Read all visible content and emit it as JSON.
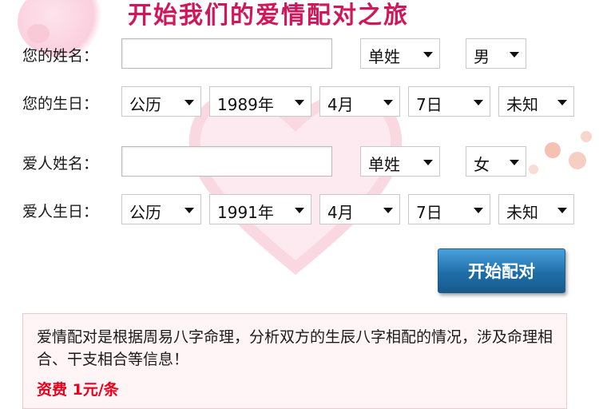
{
  "header": {
    "title": "开始我们的爱情配对之旅"
  },
  "form": {
    "your_name": {
      "label": "您的姓名：",
      "value": "",
      "surname_type": "单姓",
      "gender": "男"
    },
    "your_birthday": {
      "label": "您的生日：",
      "calendar": "公历",
      "year": "1989年",
      "month": "4月",
      "day": "7日",
      "hour": "未知"
    },
    "partner_name": {
      "label": "爱人姓名：",
      "value": "",
      "surname_type": "单姓",
      "gender": "女"
    },
    "partner_birthday": {
      "label": "爱人生日：",
      "calendar": "公历",
      "year": "1991年",
      "month": "4月",
      "day": "7日",
      "hour": "未知"
    },
    "submit_label": "开始配对"
  },
  "info": {
    "description": "爱情配对是根据周易八字命理，分析双方的生辰八字相配的情况，涉及命理相合、干支相合等信息！",
    "fee": "资费  1元/条"
  },
  "colors": {
    "title": "#d0175b",
    "button": "#1f6ea8",
    "fee": "#e8001c",
    "info_bg": "#fff5f6"
  }
}
